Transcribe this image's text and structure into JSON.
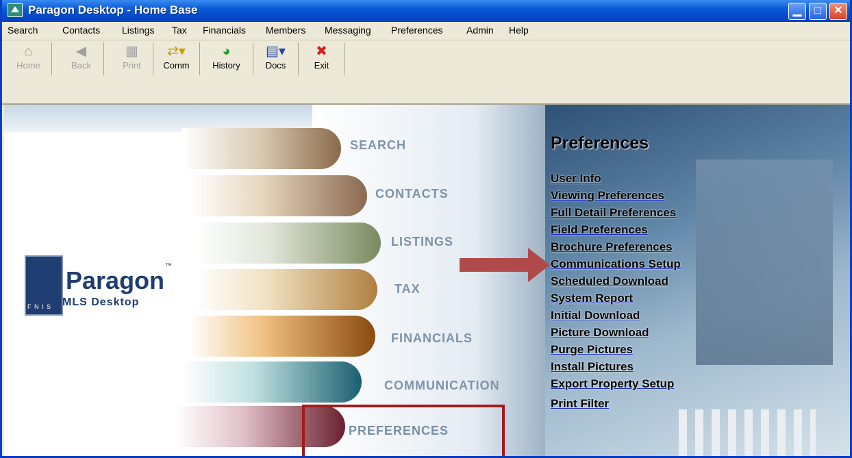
{
  "window": {
    "title": "Paragon Desktop - Home Base",
    "icon": "house-icon",
    "min_glyph": "▁",
    "max_glyph": "□",
    "close_glyph": "✕"
  },
  "menu": [
    "Search",
    "Contacts",
    "Listings",
    "Tax",
    "Financials",
    "Members",
    "Messaging",
    "Preferences",
    "Admin",
    "Help"
  ],
  "toolbar": {
    "home": "Home",
    "back": "Back",
    "print": "Print",
    "comm": "Comm",
    "history": "History",
    "docs": "Docs",
    "exit": "Exit",
    "home_icon": "⌂",
    "back_icon": "◀",
    "print_icon": "▦",
    "comm_icon": "⇄▾",
    "history_icon": "◕",
    "docs_icon": "▤▾",
    "exit_icon": "✖"
  },
  "nav": {
    "search": "SEARCH",
    "contacts": "CONTACTS",
    "listings": "LISTINGS",
    "tax": "TAX",
    "financials": "FINANCIALS",
    "communication": "COMMUNICATION",
    "preferences": "PREFERENCES"
  },
  "logo": {
    "name": "Paragon",
    "tm": "™",
    "subtitle": "MLS Desktop",
    "fnis": "F N I S"
  },
  "preferences_panel": {
    "title": "Preferences",
    "links": [
      "User Info",
      "Viewing Preferences",
      "Full Detail Preferences",
      "Field Preferences",
      "Brochure Preferences",
      "Communications Setup",
      "Scheduled Download",
      "System Report",
      "Initial Download",
      "Picture Download",
      "Purge Pictures",
      "Install Pictures",
      "Export Property Setup",
      "Print Filter"
    ]
  },
  "colors": {
    "title_bar": "#0a5ad8",
    "callout_red": "#a41a1a",
    "nav_label": "#7e93a8",
    "link_underline": "#1a2fd0"
  }
}
